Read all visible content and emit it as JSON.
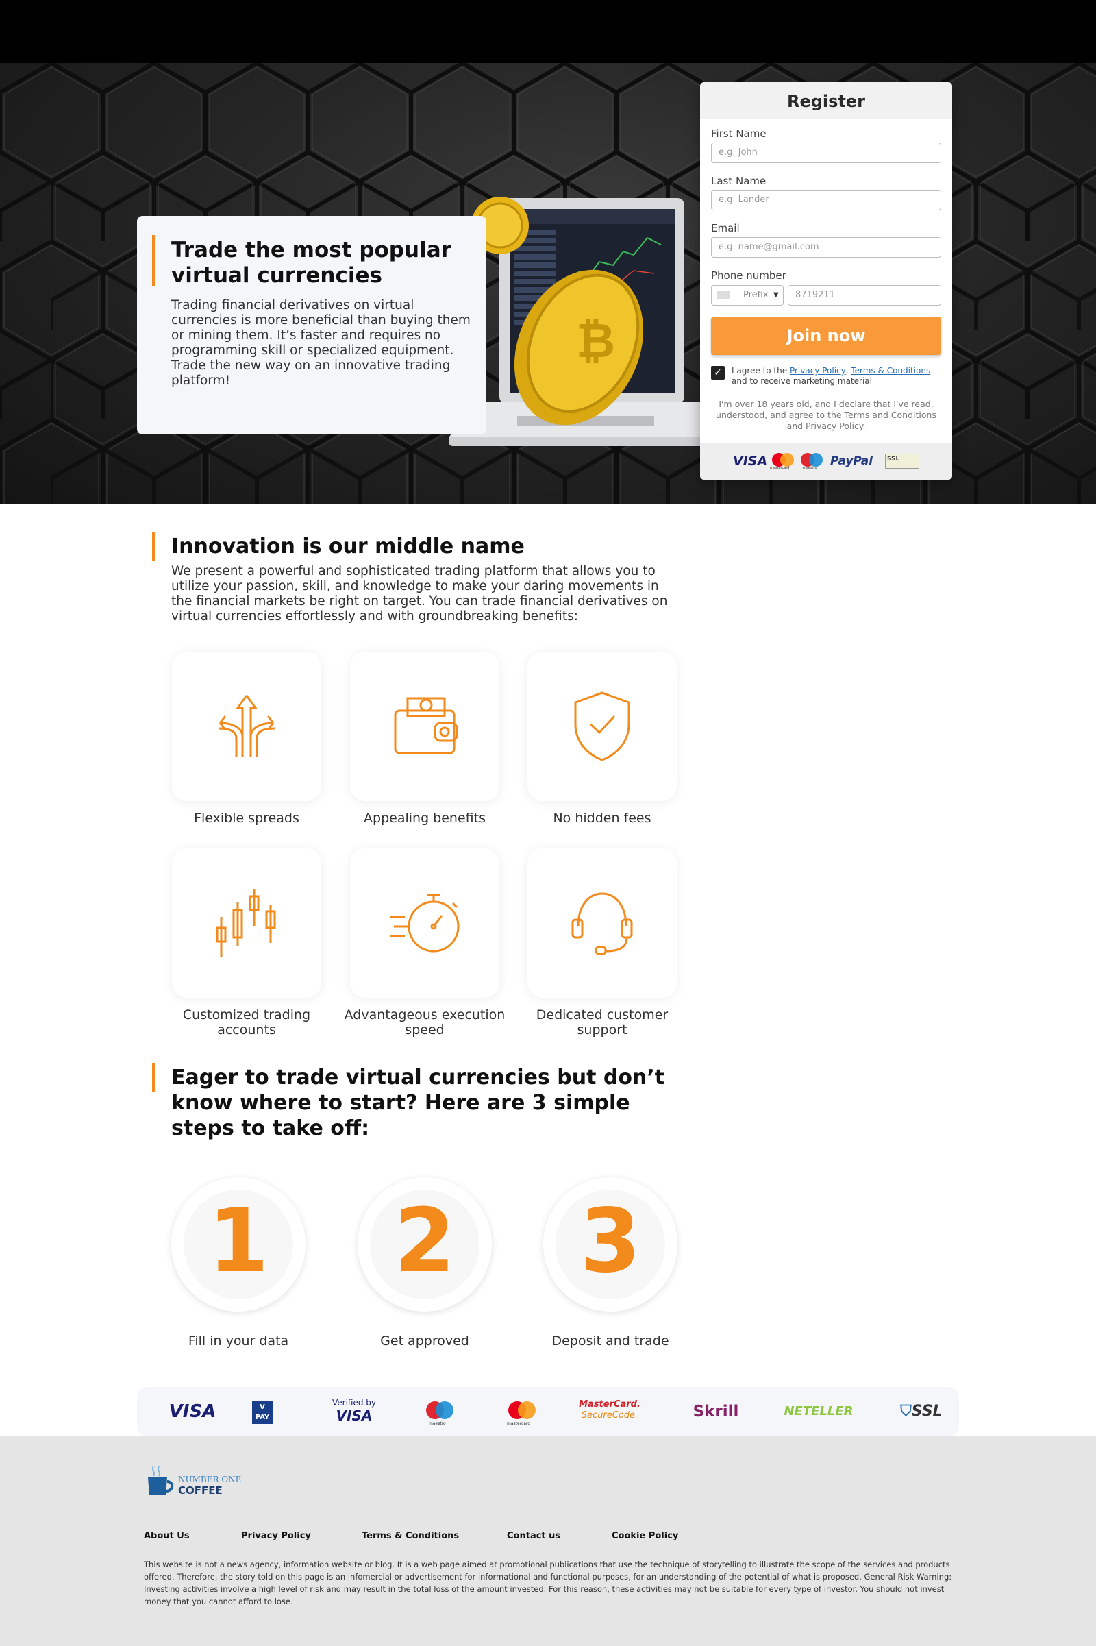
{
  "hero": {
    "title": "Trade the most popular virtual currencies",
    "text": "Trading financial derivatives on virtual currencies is more beneficial than buying them or mining them. It’s faster and requires no programming skill or specialized equipment. Trade the new way on an innovative trading platform!"
  },
  "register": {
    "title": "Register",
    "first_name_label": "First Name",
    "first_name_placeholder": "e.g. John",
    "last_name_label": "Last Name",
    "last_name_placeholder": "e.g. Lander",
    "email_label": "Email",
    "email_placeholder": "e.g. name@gmail.com",
    "phone_label": "Phone number",
    "prefix_label": "Prefix",
    "phone_placeholder": "8719211",
    "submit": "Join now",
    "agree_prefix": "I agree to the ",
    "privacy_link": "Privacy Policy",
    "comma": ", ",
    "terms_link": "Terms & Conditions",
    "agree_suffix": " and to receive marketing material",
    "disclaimer": "I'm over 18 years old, and I declare that I've read, understood, and agree to the Terms and Conditions and Privacy Policy.",
    "checked": true,
    "payment_logos": [
      "VISA",
      "mastercard",
      "maestro",
      "PayPal",
      "SSL"
    ]
  },
  "innovation": {
    "title": "Innovation is our middle name",
    "text": "We present a powerful and sophisticated trading platform that allows you to utilize your passion, skill, and knowledge to make your daring movements in the financial markets be right on target. You can trade financial derivatives on virtual currencies effortlessly and with groundbreaking benefits:"
  },
  "features": [
    {
      "label": "Flexible spreads",
      "icon": "arrows-split-icon"
    },
    {
      "label": "Appealing benefits",
      "icon": "wallet-icon"
    },
    {
      "label": "No hidden fees",
      "icon": "shield-check-icon"
    },
    {
      "label": "Customized trading accounts",
      "icon": "candlestick-icon"
    },
    {
      "label": "Advantageous execution speed",
      "icon": "stopwatch-icon"
    },
    {
      "label": "Dedicated customer support",
      "icon": "headset-icon"
    }
  ],
  "steps_section": {
    "title": "Eager to trade virtual currencies but don’t know where to start? Here are 3 simple steps to take off:"
  },
  "steps": [
    {
      "num": "1",
      "label": "Fill in your data"
    },
    {
      "num": "2",
      "label": "Get approved"
    },
    {
      "num": "3",
      "label": "Deposit and trade"
    }
  ],
  "payments": {
    "visa": "VISA",
    "vpay": "V PAY",
    "verified_top": "Verified by",
    "verified_bottom": "VISA",
    "maestro": "maestro",
    "mastercard": "mastercard",
    "securecode_top": "MasterCard.",
    "securecode_bottom": "SecureCode.",
    "skrill": "Skrill",
    "neteller": "NETELLER",
    "ssl": "SSL"
  },
  "footer": {
    "logo_top": "NUMBER ONE",
    "logo_bottom": "COFFEE",
    "links": [
      "About Us",
      "Privacy Policy",
      "Terms & Conditions",
      "Contact us",
      "Cookie Policy"
    ],
    "legal": "This website is not a news agency, information website or blog. It is a web page aimed at promotional publications that use the technique of storytelling to illustrate the scope of the services and products offered. Therefore, the story told on this page is an infomercial or advertisement for informational and functional purposes, for an understanding of the potential of what is proposed. General Risk Warning: Investing activities involve a high level of risk and may result in the total loss of the amount invested. For this reason, these activities may not be suitable for every type of investor. You should not invest money that you cannot afford to lose."
  },
  "colors": {
    "accent": "#f28a1c",
    "button": "#f99a3a",
    "footer_bg": "#e5e5e5"
  }
}
